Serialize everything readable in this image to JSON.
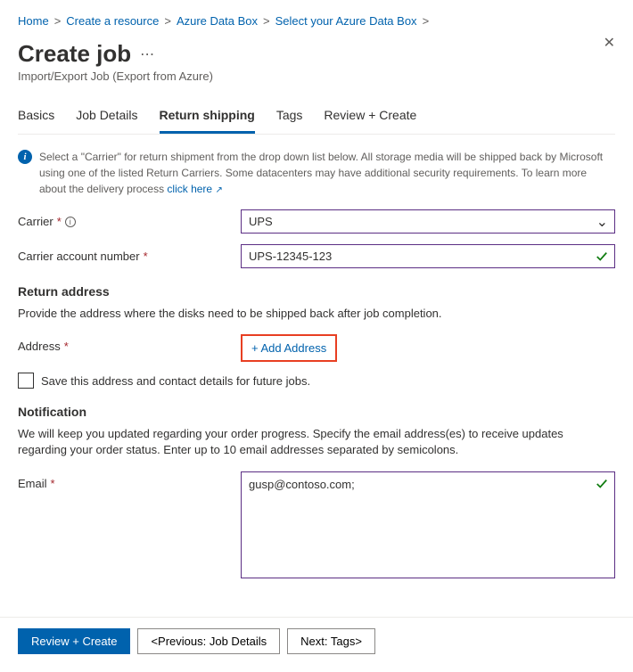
{
  "breadcrumb": {
    "items": [
      {
        "label": "Home"
      },
      {
        "label": "Create a resource"
      },
      {
        "label": "Azure Data Box"
      },
      {
        "label": "Select your Azure Data Box"
      }
    ]
  },
  "header": {
    "title": "Create job",
    "subtitle": "Import/Export Job (Export from Azure)"
  },
  "tabs": [
    {
      "label": "Basics",
      "active": false
    },
    {
      "label": "Job Details",
      "active": false
    },
    {
      "label": "Return shipping",
      "active": true
    },
    {
      "label": "Tags",
      "active": false
    },
    {
      "label": "Review + Create",
      "active": false
    }
  ],
  "info": {
    "text": "Select a \"Carrier\" for return shipment from the drop down list below. All storage media will be shipped back by Microsoft using one of the listed Return Carriers. Some datacenters may have additional security requirements. To learn more about the delivery process ",
    "link": "click here"
  },
  "carrier": {
    "label": "Carrier",
    "value": "UPS"
  },
  "account": {
    "label": "Carrier account number",
    "value": "UPS-12345-123"
  },
  "return": {
    "title": "Return address",
    "desc": "Provide the address where the disks need to be shipped back after job completion.",
    "address_label": "Address",
    "add_label": "+ Add Address",
    "save_label": "Save this address and contact details for future jobs."
  },
  "notification": {
    "title": "Notification",
    "desc": "We will keep you updated regarding your order progress. Specify the email address(es) to receive updates regarding your order status. Enter up to 10 email addresses separated by semicolons.",
    "email_label": "Email",
    "email_value": "gusp@contoso.com;"
  },
  "footer": {
    "review": "Review + Create",
    "prev": "<Previous: Job Details",
    "next": "Next: Tags>"
  }
}
